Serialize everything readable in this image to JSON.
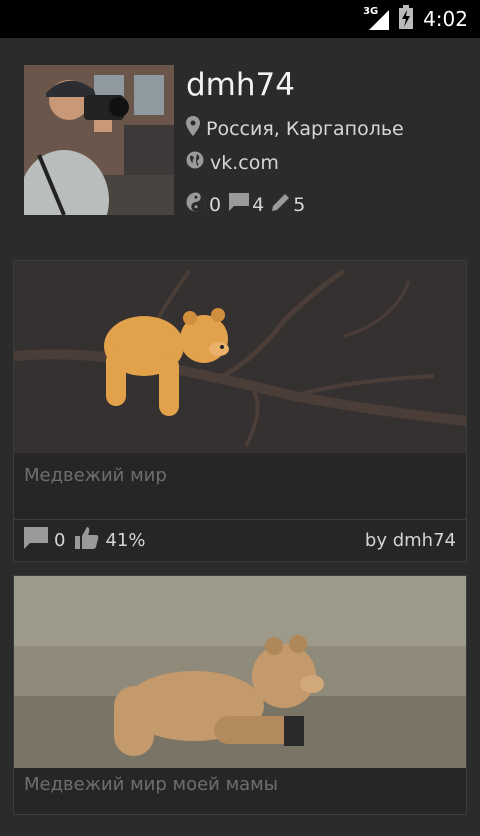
{
  "status_bar": {
    "network": "3G",
    "time": "4:02"
  },
  "profile": {
    "username": "dmh74",
    "location": "Россия, Каргаполье",
    "website": "vk.com",
    "stats": {
      "karma": "0",
      "comments": "4",
      "posts": "5"
    }
  },
  "posts": [
    {
      "title": "Медвежий мир",
      "comments": "0",
      "rating": "41%",
      "author": "by dmh74"
    },
    {
      "title": "Медвежий мир моей мамы"
    }
  ],
  "colors": {
    "background": "#2b2b2b",
    "card": "#262626",
    "status_bar": "#000000",
    "text_primary": "#f2f2f2",
    "text_muted": "#6e6e6e"
  }
}
